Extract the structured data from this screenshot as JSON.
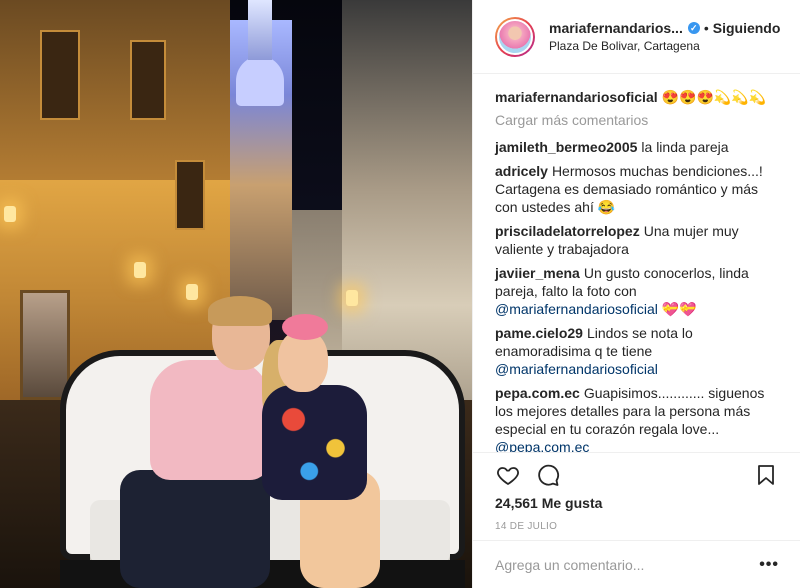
{
  "post": {
    "username": "mariafernandarios...",
    "follow_label": "Siguiendo",
    "separator": "•",
    "location": "Plaza De Bolivar, Cartagena",
    "verified_icon": "verified-badge-icon",
    "accent_color": "#3897f0"
  },
  "comments": {
    "caption": {
      "user": "mariafernandariosoficial",
      "text": "😍😍😍💫💫💫"
    },
    "load_more": "Cargar más comentarios",
    "items": [
      {
        "user": "jamileth_bermeo2005",
        "text": "la linda pareja"
      },
      {
        "user": "adricely",
        "text": "Hermosos muchas bendiciones...! Cartagena es demasiado romántico y más con ustedes ahí 😂"
      },
      {
        "user": "prisciladelatorrelopez",
        "text": "Una mujer muy valiente y trabajadora"
      },
      {
        "user": "javiier_mena",
        "text": "Un gusto conocerlos, linda pareja, falto la foto con",
        "mention": "@mariafernandariosoficial",
        "after": " 💝💝"
      },
      {
        "user": "pame.cielo29",
        "text": "Lindos se nota lo enamoradisima q te tiene",
        "mention": "@mariafernandariosoficial",
        "after": ""
      },
      {
        "user": "pepa.com.ec",
        "text": "Guapisimos............ siguenos los mejores detalles para la persona más especial en tu corazón regala love...",
        "mention": "@pepa.com.ec",
        "after": ""
      }
    ]
  },
  "actions": {
    "like_icon": "heart-icon",
    "comment_icon": "comment-bubble-icon",
    "save_icon": "bookmark-icon",
    "likes": "24,561 Me gusta",
    "date": "14 DE JULIO"
  },
  "composer": {
    "placeholder": "Agrega un comentario...",
    "more_label": "•••"
  }
}
